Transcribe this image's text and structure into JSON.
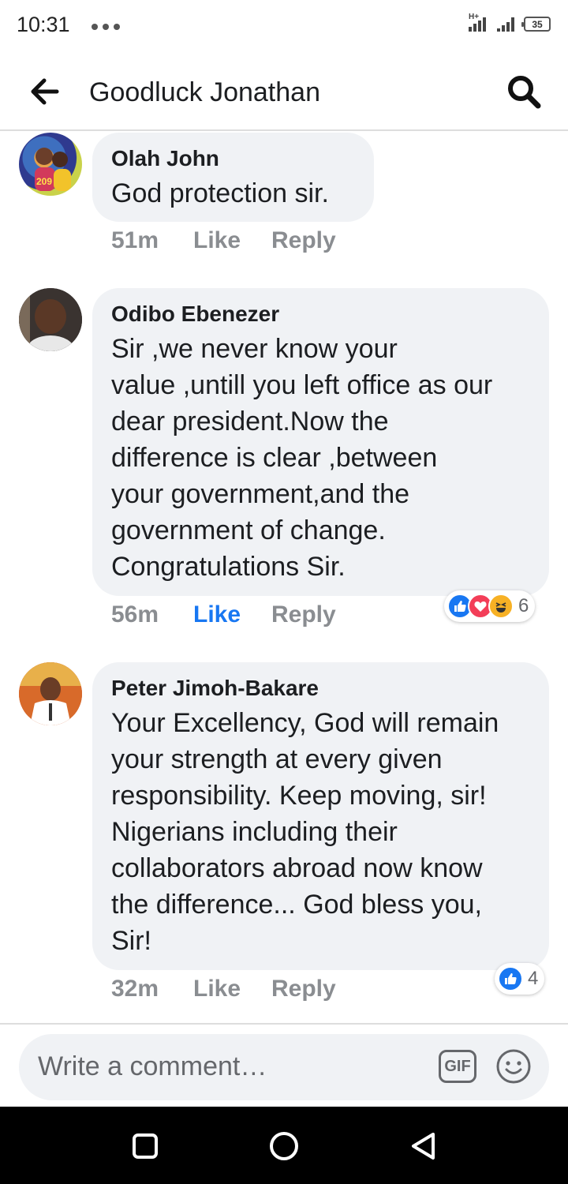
{
  "status_bar": {
    "time": "10:31",
    "network": "H+",
    "battery": "35"
  },
  "header": {
    "title": "Goodluck Jonathan"
  },
  "comments": [
    {
      "author": "Olah John",
      "text": "God protection sir.",
      "time": "51m",
      "like_label": "Like",
      "reply_label": "Reply",
      "liked": false
    },
    {
      "author": "Odibo Ebenezer",
      "text_lines": [
        "Sir ,we never know your",
        "value ,untill you left office as our",
        "dear president.Now the",
        "difference is clear ,between",
        "your government,and the",
        "government of change.",
        "Congratulations Sir."
      ],
      "time": "56m",
      "like_label": "Like",
      "reply_label": "Reply",
      "liked": true,
      "reactions": [
        "like-icon",
        "love-icon",
        "haha-icon"
      ],
      "reaction_count": "6"
    },
    {
      "author": "Peter Jimoh-Bakare",
      "text_lines": [
        "Your Excellency, God will remain",
        "your strength at every given",
        "responsibility. Keep moving, sir!",
        "Nigerians including their",
        "collaborators abroad now know",
        "the difference... God bless you,",
        "Sir!"
      ],
      "time": "32m",
      "like_label": "Like",
      "reply_label": "Reply",
      "liked": false,
      "reactions": [
        "like-icon"
      ],
      "reaction_count": "4"
    }
  ],
  "composer": {
    "placeholder": "Write a comment…",
    "gif_label": "GIF"
  },
  "colors": {
    "accent": "#1877f2",
    "bubble": "#f0f2f5",
    "muted": "#8a8d91"
  }
}
